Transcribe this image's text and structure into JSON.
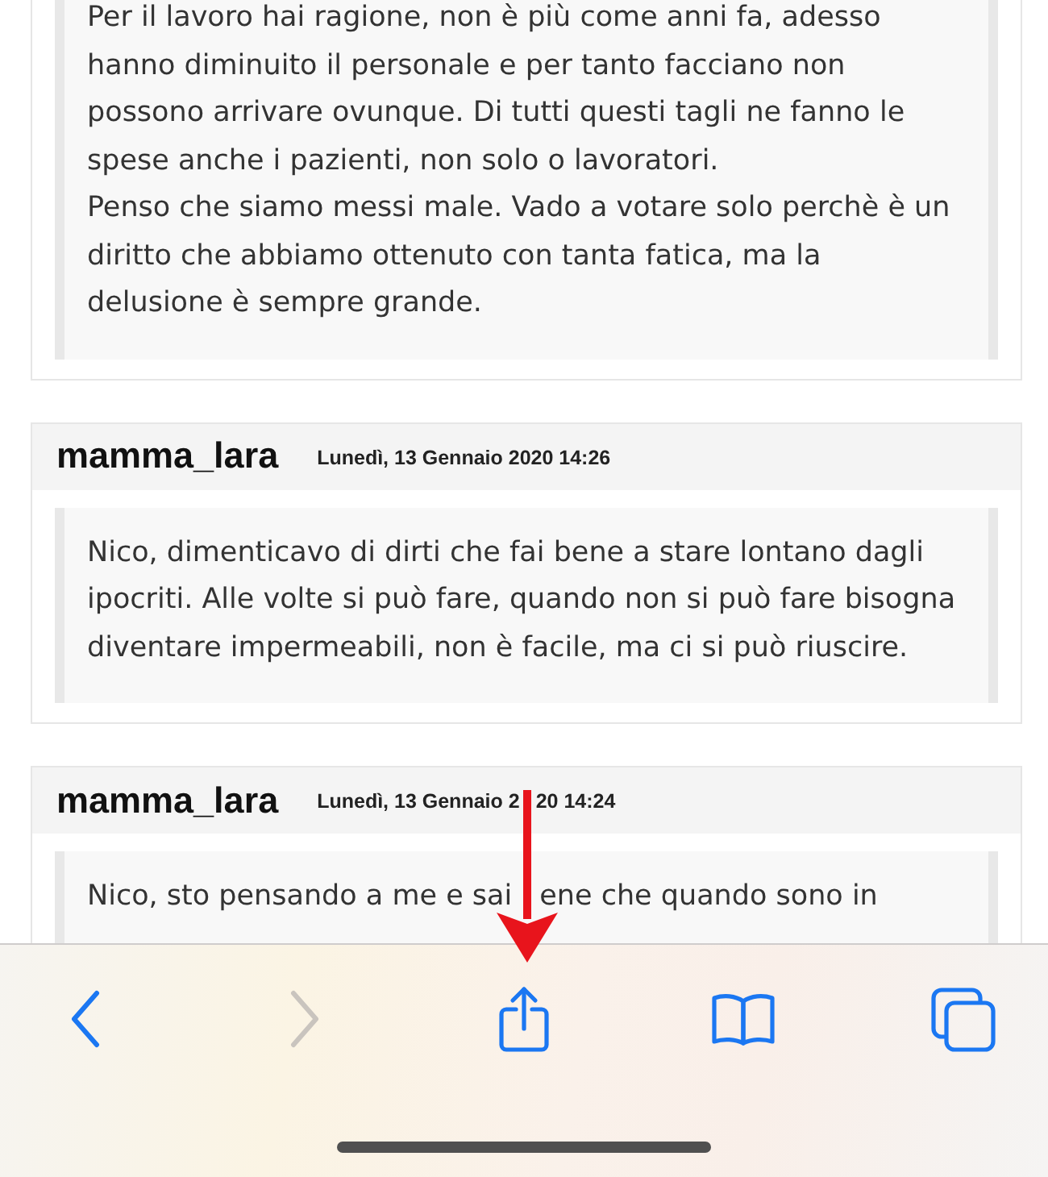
{
  "posts": [
    {
      "paragraphs": [
        "Per il lavoro hai ragione, non è più come anni fa, adesso hanno diminuito il personale e per tanto facciano non possono arrivare ovunque. Di tutti questi tagli ne fanno le spese anche i pazienti, non solo o lavoratori.",
        "Penso che siamo messi male. Vado a votare solo perchè è un diritto che abbiamo ottenuto con tanta fatica, ma la delusione è sempre grande."
      ]
    },
    {
      "author": "mamma_lara",
      "date": "Lunedì, 13 Gennaio 2020 14:26",
      "paragraphs": [
        "Nico, dimenticavo di dirti che fai bene a stare lontano dagli ipocriti. Alle volte si può fare, quando non si può fare bisogna diventare impermeabili, non è facile, ma ci si può riuscire."
      ]
    },
    {
      "author": "mamma_lara",
      "date": [
        "Lunedì, 13 Gennaio 2",
        "20 14:24"
      ],
      "paragraphs": [
        [
          "Nico, sto pensando a me e sai",
          "ene che quando sono in"
        ]
      ]
    }
  ],
  "toolbar": {
    "buttons": [
      {
        "kind": "back",
        "disabled": false
      },
      {
        "kind": "forward",
        "disabled": true
      },
      {
        "kind": "share",
        "disabled": false
      },
      {
        "kind": "bookmarks",
        "disabled": false
      },
      {
        "kind": "tabs",
        "disabled": false
      }
    ]
  }
}
